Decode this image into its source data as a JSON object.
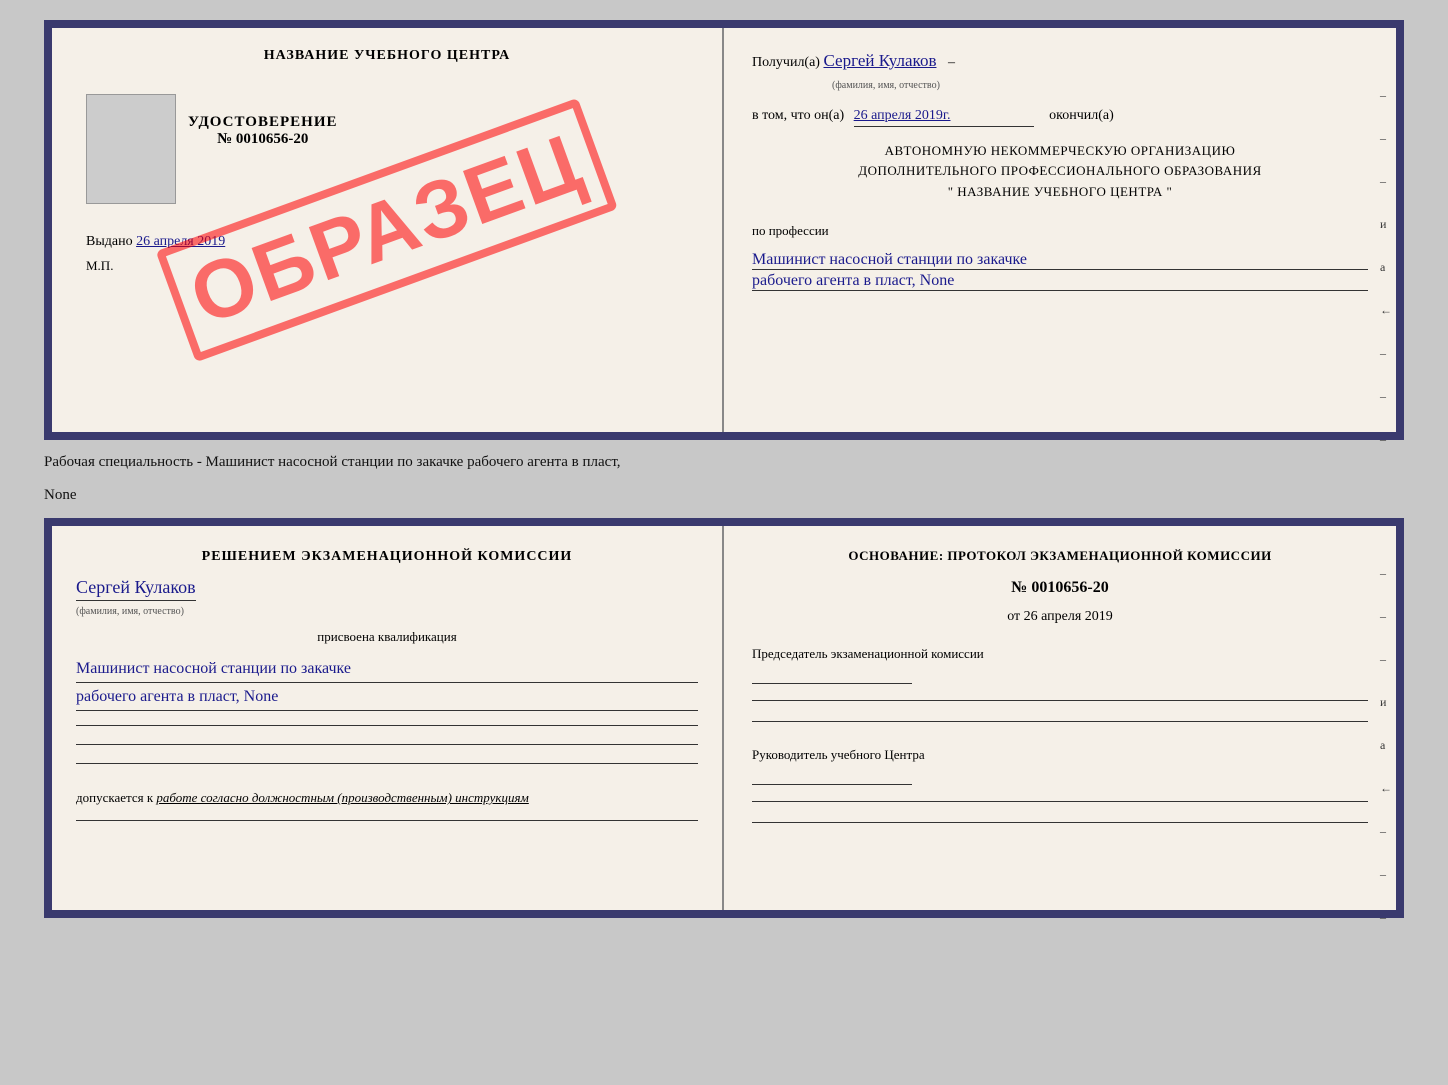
{
  "topDoc": {
    "left": {
      "centerName": "НАЗВАНИЕ УЧЕБНОГО ЦЕНТРА",
      "udostoverenie": "УДОСТОВЕРЕНИЕ",
      "number": "№ 0010656-20",
      "vydano": "Выдано",
      "vydanoDate": "26 апреля 2019",
      "mp": "М.П.",
      "stamp": "ОБРАЗЕЦ"
    },
    "right": {
      "poluchilLabel": "Получил(a)",
      "poluchilName": "Сергей Кулаков",
      "familiyaLabel": "(фамилия, имя, отчество)",
      "vTomChto": "в том, что он(а)",
      "date": "26 апреля 2019г.",
      "okonchilLabel": "окончил(а)",
      "orgLine1": "АВТОНОМНУЮ НЕКОММЕРЧЕСКУЮ ОРГАНИЗАЦИЮ",
      "orgLine2": "ДОПОЛНИТЕЛЬНОГО ПРОФЕССИОНАЛЬНОГО ОБРАЗОВАНИЯ",
      "orgLine3": "\"   НАЗВАНИЕ УЧЕБНОГО ЦЕНТРА   \"",
      "poProfilessii": "по профессии",
      "profession1": "Машинист насосной станции по закачке",
      "profession2": "рабочего агента в пласт, None",
      "dashes": [
        "-",
        "-",
        "-",
        "-",
        "и",
        "а",
        "←",
        "-",
        "-",
        "-"
      ]
    }
  },
  "middleText": "Рабочая специальность - Машинист насосной станции по закачке рабочего агента в пласт,",
  "middleText2": "None",
  "bottomDoc": {
    "left": {
      "resheniem": "Решением экзаменационной комиссии",
      "name": "Сергей Кулаков",
      "familiyaLabel": "(фамилия, имя, отчество)",
      "prisvoena": "присвоена квалификация",
      "qualification1": "Машинист насосной станции по закачке",
      "qualification2": "рабочего агента в пласт, None",
      "dopuskaetsya": "допускается к",
      "dopuskaetsyaItalic": "работе согласно должностным (производственным) инструкциям"
    },
    "right": {
      "osnovanieLabel": "Основание: протокол экзаменационной комиссии",
      "protocolNumber": "№ 0010656-20",
      "ot": "от",
      "date": "26 апреля 2019",
      "predsedatel": "Председатель экзаменационной комиссии",
      "rukovoditel": "Руководитель учебного Центра",
      "dashes": [
        "-",
        "-",
        "-",
        "-",
        "и",
        "а",
        "←",
        "-",
        "-",
        "-"
      ]
    }
  }
}
